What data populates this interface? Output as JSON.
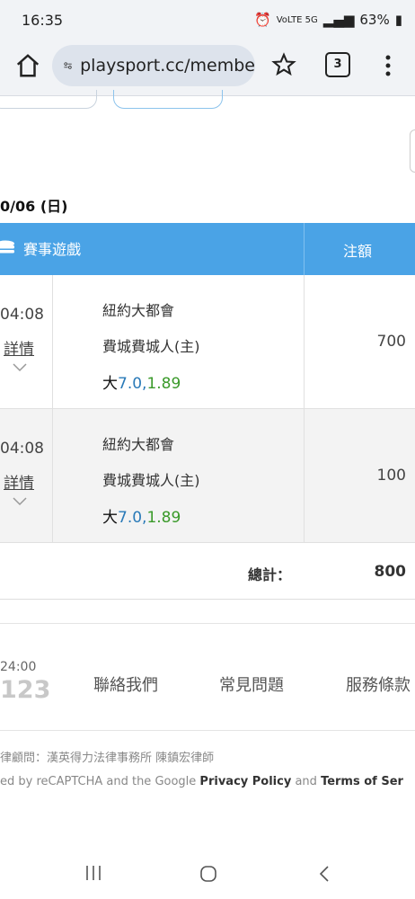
{
  "status_bar": {
    "time": "16:35",
    "signal": "VoLTE 5G",
    "battery": "63%"
  },
  "browser": {
    "url": "playsport.cc/membe",
    "tab_count": "3"
  },
  "date_heading": "0/06 (日)",
  "table": {
    "header_game": "賽事遊戲",
    "header_amount": "注額",
    "rows": [
      {
        "time": "04:08",
        "detail": "詳情",
        "team_away": "紐約大都會",
        "team_home": "費城費城人(主)",
        "bet_type": "大",
        "bet_line": "7.0,",
        "bet_odds": "1.89",
        "amount": "700"
      },
      {
        "time": "04:08",
        "detail": "詳情",
        "team_away": "紐約大都會",
        "team_home": "費城費城人(主)",
        "bet_type": "大",
        "bet_line": "7.0,",
        "bet_odds": "1.89",
        "amount": "100"
      }
    ],
    "total_label": "總計：",
    "total_value": "800"
  },
  "footer": {
    "hours": "24:00",
    "hours_big": "123",
    "links": [
      "聯絡我們",
      "常見問題",
      "服務條款"
    ],
    "legal": "律顧問：漢英得力法律事務所 陳鎮宏律師",
    "recaptcha_prefix": "ed by reCAPTCHA and the Google ",
    "privacy": "Privacy Policy",
    "and": " and ",
    "terms": "Terms of Ser"
  }
}
